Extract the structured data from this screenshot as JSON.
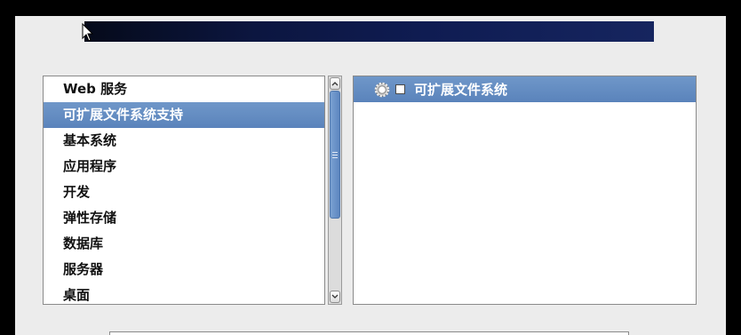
{
  "groups": {
    "items": [
      {
        "label": "Web 服务",
        "selected": false
      },
      {
        "label": "可扩展文件系统支持",
        "selected": true
      },
      {
        "label": "基本系统",
        "selected": false
      },
      {
        "label": "应用程序",
        "selected": false
      },
      {
        "label": "开发",
        "selected": false
      },
      {
        "label": "弹性存储",
        "selected": false
      },
      {
        "label": "数据库",
        "selected": false
      },
      {
        "label": "服务器",
        "selected": false
      },
      {
        "label": "桌面",
        "selected": false
      }
    ],
    "scroll_position": 0.0
  },
  "addons": {
    "items": [
      {
        "label": "可扩展文件系统",
        "checked": false,
        "icon": "gear-icon"
      }
    ]
  },
  "colors": {
    "selection": "#5f89c1",
    "window_bg": "#ececec",
    "banner": "#0f1c52"
  }
}
